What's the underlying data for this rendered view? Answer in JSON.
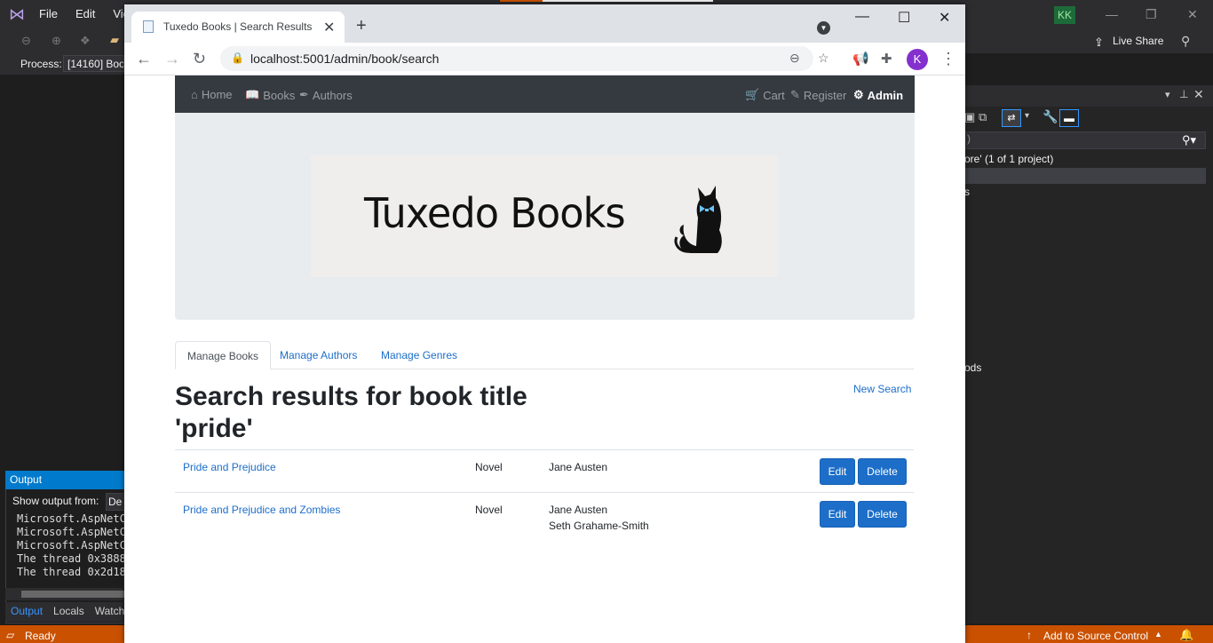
{
  "vs": {
    "menu": [
      "File",
      "Edit",
      "Vie"
    ],
    "avatar": "KK",
    "live_share": "Live Share",
    "process_label": "Process:",
    "process_value": "[14160] Boo",
    "solution_line": "ore' (1 of 1 project)",
    "tree_item": "s",
    "tree_item2": "ods",
    "output": {
      "title": "Output",
      "show_from": "Show output from:",
      "source": "De",
      "lines": [
        "Microsoft.AspNetC",
        "Microsoft.AspNetC",
        "Microsoft.AspNetC",
        "The thread 0x3888",
        "The thread 0x2d18"
      ],
      "tabs": [
        "Output",
        "Locals",
        "Watch"
      ]
    },
    "status": {
      "ready": "Ready",
      "source_control": "Add to Source Control"
    }
  },
  "browser": {
    "tab_title": "Tuxedo Books | Search Results",
    "url": "localhost:5001/admin/book/search",
    "profile_initial": "K"
  },
  "site": {
    "nav_left": [
      {
        "icon": "home-icon",
        "label": "Home"
      },
      {
        "icon": "book-icon",
        "label": "Books"
      },
      {
        "icon": "feather-icon",
        "label": "Authors"
      }
    ],
    "nav_right": [
      {
        "icon": "cart-icon",
        "label": "Cart"
      },
      {
        "icon": "edit-icon",
        "label": "Register"
      },
      {
        "icon": "gear-icon",
        "label": "Admin"
      }
    ],
    "logo_text": "Tuxedo Books",
    "admin_tabs": [
      "Manage Books",
      "Manage Authors",
      "Manage Genres"
    ],
    "heading": "Search results for book title 'pride'",
    "new_search": "New Search",
    "results": [
      {
        "title": "Pride and Prejudice",
        "genre": "Novel",
        "authors": [
          "Jane Austen"
        ],
        "edit": "Edit",
        "delete": "Delete"
      },
      {
        "title": "Pride and Prejudice and Zombies",
        "genre": "Novel",
        "authors": [
          "Jane Austen",
          "Seth Grahame-Smith"
        ],
        "edit": "Edit",
        "delete": "Delete"
      }
    ]
  },
  "colors": {
    "navbar": "#343a40",
    "link": "#1c6ec9",
    "button": "#1c6ec9",
    "vs_status": "#ca5100"
  }
}
